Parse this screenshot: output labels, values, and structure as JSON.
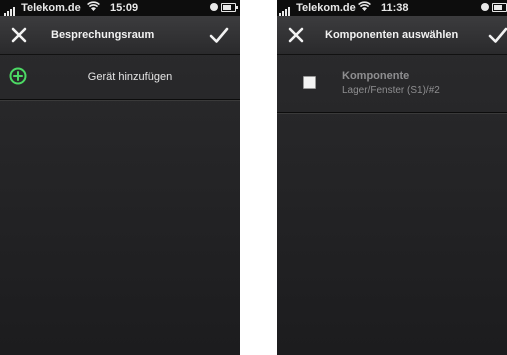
{
  "left_screen": {
    "status": {
      "carrier": "Telekom.de",
      "time": "15:09"
    },
    "nav": {
      "title": "Besprechungsraum"
    },
    "add_row": {
      "label": "Gerät hinzufügen"
    }
  },
  "right_screen": {
    "status": {
      "carrier": "Telekom.de",
      "time": "11:38"
    },
    "nav": {
      "title": "Komponenten auswählen"
    },
    "component": {
      "title": "Komponente",
      "subtitle": "Lager/Fenster (S1)/#2",
      "checked": false
    }
  },
  "colors": {
    "background": "#1c1c1e",
    "navbar": "#333335",
    "add_icon": "#4cd964",
    "text_primary": "#e6e6e6",
    "text_muted": "#8e8e90"
  },
  "icons": [
    "close-icon",
    "checkmark-icon",
    "add-circle-icon",
    "signal-bars-icon",
    "wifi-icon",
    "alarm-icon",
    "battery-icon"
  ]
}
